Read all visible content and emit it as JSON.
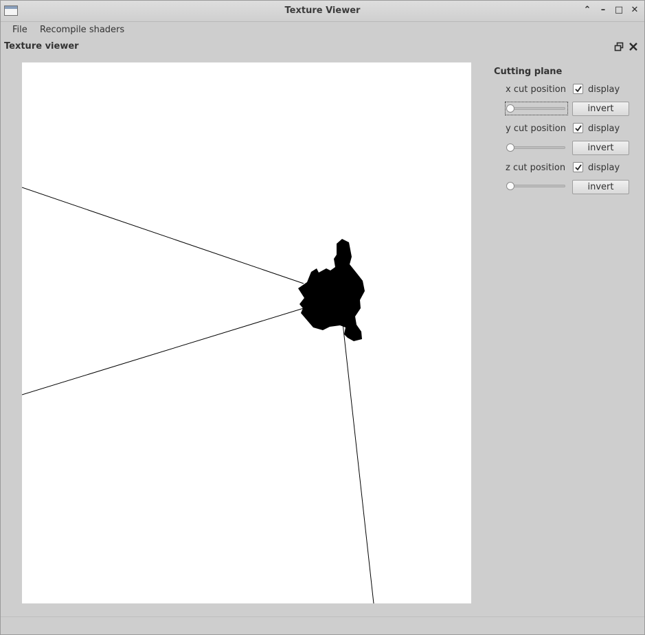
{
  "window": {
    "title": "Texture Viewer",
    "controls": {
      "shade": "⌃",
      "minimize": "–",
      "maximize": "□",
      "close": "✕"
    }
  },
  "menubar": {
    "items": [
      "File",
      "Recompile shaders"
    ]
  },
  "dock": {
    "title": "Texture viewer",
    "float_icon": "float-icon",
    "close_icon": "close-icon"
  },
  "cutting_plane": {
    "title": "Cutting plane",
    "rows": [
      {
        "label": "x cut position",
        "display_label": "display",
        "display_checked": true,
        "slider_value": 0,
        "invert_label": "invert",
        "focused": true
      },
      {
        "label": "y cut position",
        "display_label": "display",
        "display_checked": true,
        "slider_value": 0,
        "invert_label": "invert",
        "focused": false
      },
      {
        "label": "z cut position",
        "display_label": "display",
        "display_checked": true,
        "slider_value": 0,
        "invert_label": "invert",
        "focused": false
      }
    ]
  },
  "colors": {
    "background": "#cecece",
    "viewport": "#ffffff",
    "object": "#000000"
  }
}
